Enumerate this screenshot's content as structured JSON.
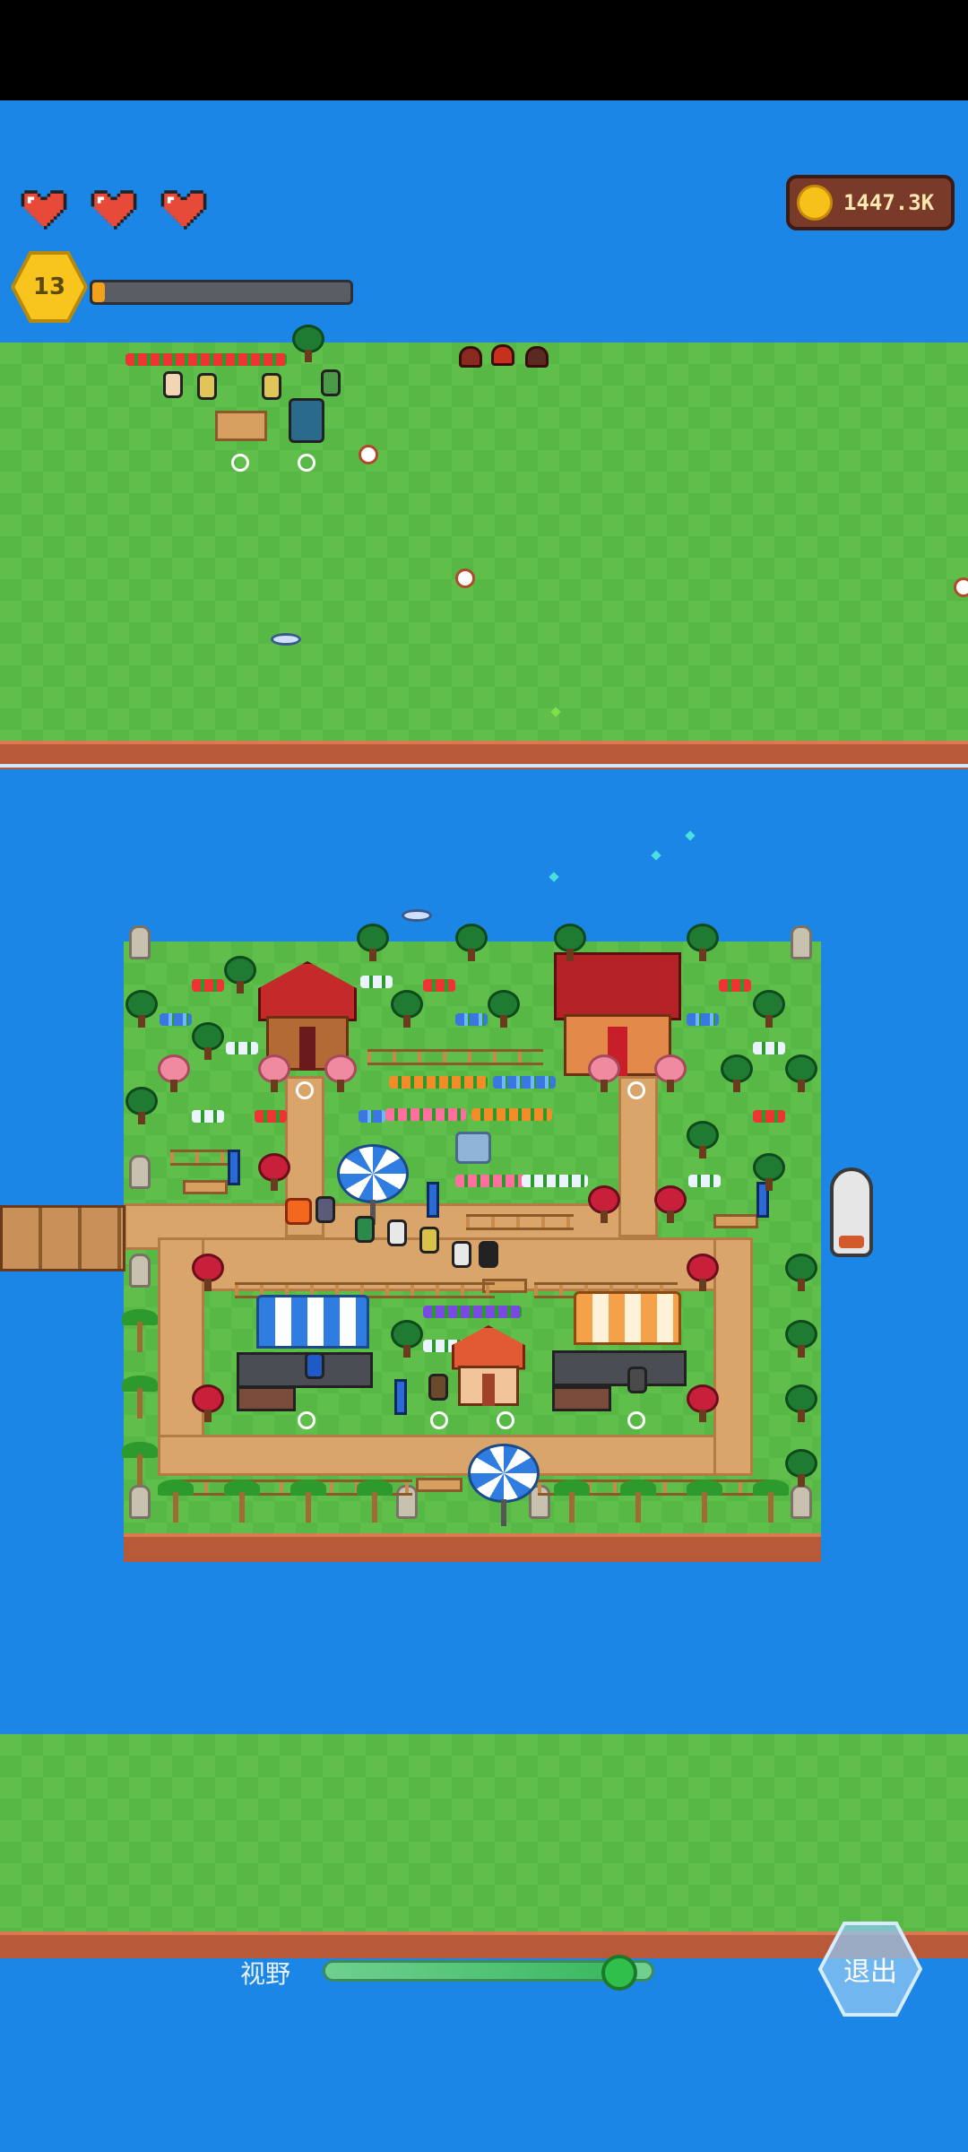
{
  "hud": {
    "hearts": {
      "count": 3,
      "icon": "heart-icon",
      "color": "#e84a3a"
    },
    "level": {
      "value": "13",
      "xp_progress": 0.05,
      "badge_color": "#f7c51e"
    },
    "coins": {
      "amount": "1447.3K",
      "icon": "coin-icon"
    }
  },
  "controls": {
    "view_label": "视野",
    "view_zoom": 0.9,
    "exit_label": "退出"
  },
  "colors": {
    "water": "#1b86e6",
    "grass": "#5fbf4a",
    "path": "#d9a56a",
    "shore": "#b85a3a"
  },
  "scene": {
    "top_field": [
      "stall-row-icons",
      "farmer",
      "workbench",
      "scarecrow",
      "tractor",
      "chicken",
      "mushrooms",
      "bird"
    ],
    "main_island": [
      "wood-house",
      "brick-house",
      "flower-beds",
      "fountain",
      "market-stall-blue",
      "market-stall-orange",
      "small-house",
      "umbrellas",
      "villagers",
      "statues",
      "palm-trees",
      "dock",
      "boat"
    ]
  }
}
